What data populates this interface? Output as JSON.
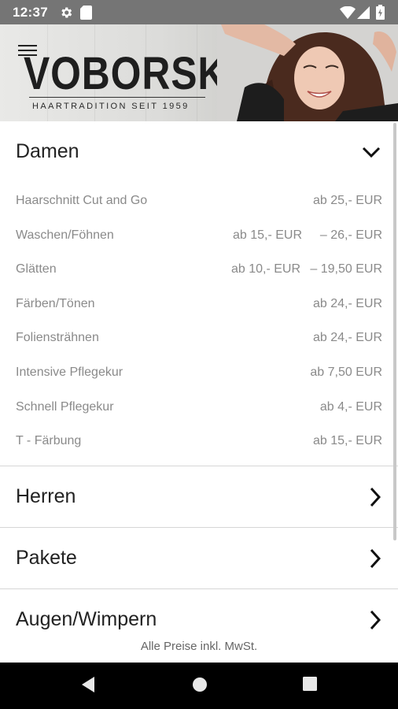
{
  "status_bar": {
    "time": "12:37",
    "icons": [
      "gear-icon",
      "sd-card-icon",
      "wifi-icon",
      "signal-icon",
      "battery-icon"
    ]
  },
  "header": {
    "brand": "VOBORSKY",
    "tagline": "HAARTRADITION SEIT 1959",
    "menu_icon": "hamburger-menu-icon"
  },
  "sections": [
    {
      "title": "Damen",
      "expanded": true,
      "items": [
        {
          "name": "Haarschnitt Cut and Go",
          "price_from": "",
          "price": "ab 25,- EUR"
        },
        {
          "name": "Waschen/Föhnen",
          "price_from": "ab 15,- EUR",
          "price": "– 26,- EUR"
        },
        {
          "name": "Glätten",
          "price_from": "ab 10,- EUR",
          "price": "– 19,50 EUR"
        },
        {
          "name": "Färben/Tönen",
          "price_from": "",
          "price": "ab 24,- EUR"
        },
        {
          "name": "Foliensträhnen",
          "price_from": "",
          "price": "ab 24,- EUR"
        },
        {
          "name": "Intensive Pflegekur",
          "price_from": "",
          "price": "ab 7,50 EUR"
        },
        {
          "name": "Schnell Pflegekur",
          "price_from": "",
          "price": "ab 4,- EUR"
        },
        {
          "name": "T - Färbung",
          "price_from": "",
          "price": "ab 15,- EUR"
        }
      ]
    },
    {
      "title": "Herren",
      "expanded": false
    },
    {
      "title": "Pakete",
      "expanded": false
    },
    {
      "title": "Augen/Wimpern",
      "expanded": false
    }
  ],
  "footer": {
    "note": "Alle Preise inkl. MwSt."
  },
  "nav": {
    "back": "back-icon",
    "home": "home-icon",
    "recents": "recents-icon"
  },
  "colors": {
    "status_bar": "#757575",
    "nav_bar": "#000000",
    "price_text": "#8a8a8a",
    "divider": "#d6d6d6"
  }
}
